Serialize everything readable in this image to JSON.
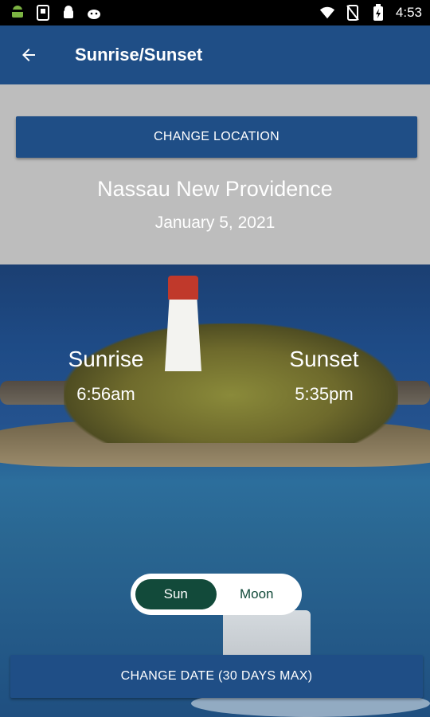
{
  "status_bar": {
    "time": "4:53",
    "left_icons": [
      "android-icon",
      "sim-icon",
      "android-icon",
      "android-head-icon"
    ],
    "right_icons": [
      "wifi-icon",
      "no-sim-icon",
      "battery-charging-icon"
    ]
  },
  "app_bar": {
    "title": "Sunrise/Sunset"
  },
  "location": {
    "button_label": "CHANGE LOCATION",
    "name": "Nassau New Providence",
    "date": "January 5, 2021"
  },
  "times": {
    "sunrise_label": "Sunrise",
    "sunrise_time": "6:56am",
    "sunset_label": "Sunset",
    "sunset_time": "5:35pm"
  },
  "toggle": {
    "options": [
      "Sun",
      "Moon"
    ],
    "selected": "Sun"
  },
  "footer": {
    "button_label": "CHANGE DATE (30 DAYS MAX)"
  },
  "colors": {
    "primary": "#1f4e86",
    "toggle_active": "#124a3a",
    "sky": "#bdbdbd"
  }
}
